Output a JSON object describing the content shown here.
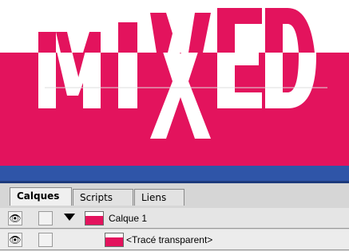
{
  "artwork": {
    "text": "MIXED",
    "colors": {
      "background": "#e3135d",
      "letters": "#ffffff",
      "band": "#2f55a8"
    }
  },
  "panel": {
    "tabs": [
      {
        "label": "Calques"
      },
      {
        "label": "Scripts"
      },
      {
        "label": "Liens"
      }
    ],
    "layers": [
      {
        "name": "Calque 1"
      },
      {
        "name": "<Tracé transparent>"
      }
    ]
  }
}
